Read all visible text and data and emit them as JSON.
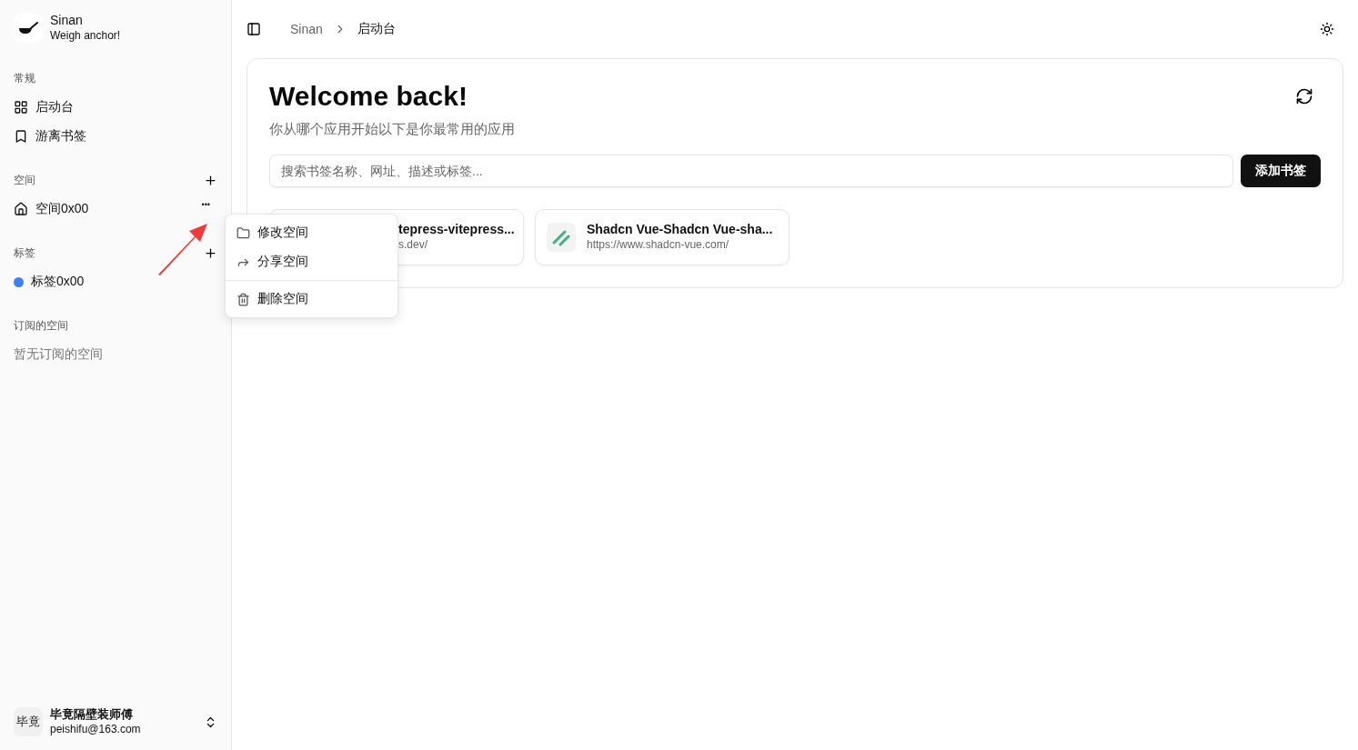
{
  "app": {
    "name": "Sinan",
    "tagline": "Weigh anchor!"
  },
  "sidebar": {
    "groups": [
      {
        "title": "常规",
        "add": false,
        "items": [
          {
            "kind": "nav",
            "label": "启动台"
          },
          {
            "kind": "nav",
            "label": "游离书签"
          }
        ]
      },
      {
        "title": "空间",
        "add": true,
        "items": [
          {
            "kind": "nav",
            "label": "空间0x00",
            "more": "•••"
          }
        ]
      },
      {
        "title": "标签",
        "add": true,
        "items": [
          {
            "kind": "tag",
            "color": "#3b82f6",
            "label": "标签0x00"
          }
        ]
      },
      {
        "title": "订阅的空间",
        "add": false,
        "items": [
          {
            "kind": "empty",
            "label": "暂无订阅的空间"
          }
        ]
      }
    ]
  },
  "user": {
    "avatar": "毕竟",
    "name": "毕竟隔壁装师傅",
    "email": "peishifu@163.com"
  },
  "breadcrumb": [
    "Sinan",
    "启动台"
  ],
  "main": {
    "title": "Welcome back!",
    "subtitle": "你从哪个应用开始以下是你最常用的应用",
    "search": {
      "placeholder": "搜索书签名称、网址、描述或标签..."
    },
    "add_button": "添加书签",
    "bookmarks": [
      {
        "kind": "covered",
        "title": "tepress-vitepress...",
        "url": "s.dev/"
      },
      {
        "kind": "full",
        "title": "Shadcn Vue-Shadcn Vue-sha...",
        "url": "https://www.shadcn-vue.com/"
      }
    ]
  },
  "context_menu": {
    "items": [
      {
        "kind": "item",
        "label": "修改空间"
      },
      {
        "kind": "item",
        "label": "分享空间"
      },
      {
        "kind": "separator"
      },
      {
        "kind": "item",
        "label": "删除空间"
      }
    ]
  }
}
